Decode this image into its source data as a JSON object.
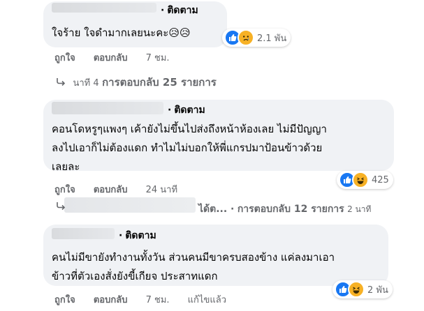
{
  "comments": [
    {
      "follow_label": "ติดตาม",
      "text_lines": [
        "ใจร้าย ใจดำมากเลยนะคะ😥😥"
      ],
      "reaction_count": "2.1 พัน",
      "like_label": "ถูกใจ",
      "reply_label": "ตอบกลับ",
      "time": "7 ชม."
    },
    {
      "follow_label": "ติดตาม",
      "text_lines": [
        "คอนโดหรูๆแพงๆ เค้ายังไม่ขึ้นไปส่งถึงหน้าห้องเลย ไม่มีปัญญา",
        "ลงไปเอาก็ไม่ต้องแดก ทำไมไม่บอกให้พี่แกรปมาป้อนข้าวด้วย",
        "เลยละ"
      ],
      "reaction_count": "425",
      "like_label": "ถูกใจ",
      "reply_label": "ตอบกลับ",
      "time": "24 นาที"
    },
    {
      "follow_label": "ติดตาม",
      "text_lines": [
        "คนไม่มีขายังทำงานทั้งวัน ส่วนคนมีขาครบสองข้าง แค่ลงมาเอา",
        "ข้าวที่ตัวเองสั่งยังขี้เกียจ ประสาทแดก"
      ],
      "reaction_count": "2 พัน",
      "like_label": "ถูกใจ",
      "reply_label": "ตอบกลับ",
      "time": "7 ชม.",
      "edited_label": "แก้ไขแล้ว"
    }
  ],
  "reply_threads": [
    {
      "prefix": "นาที 4",
      "label": "การตอบกลับ 25 รายการ"
    },
    {
      "prefix": "ได้ต... ·",
      "label": "การตอบกลับ 12 รายการ",
      "time": "2 นาที"
    }
  ],
  "icons": [
    "like-icon",
    "haha-icon",
    "sad-icon",
    "reply-arrow-icon"
  ],
  "colors": {
    "bubble": "#f0f2f5",
    "muted": "#65676b",
    "like": "#1877f2",
    "emoji": "#f7b125"
  }
}
